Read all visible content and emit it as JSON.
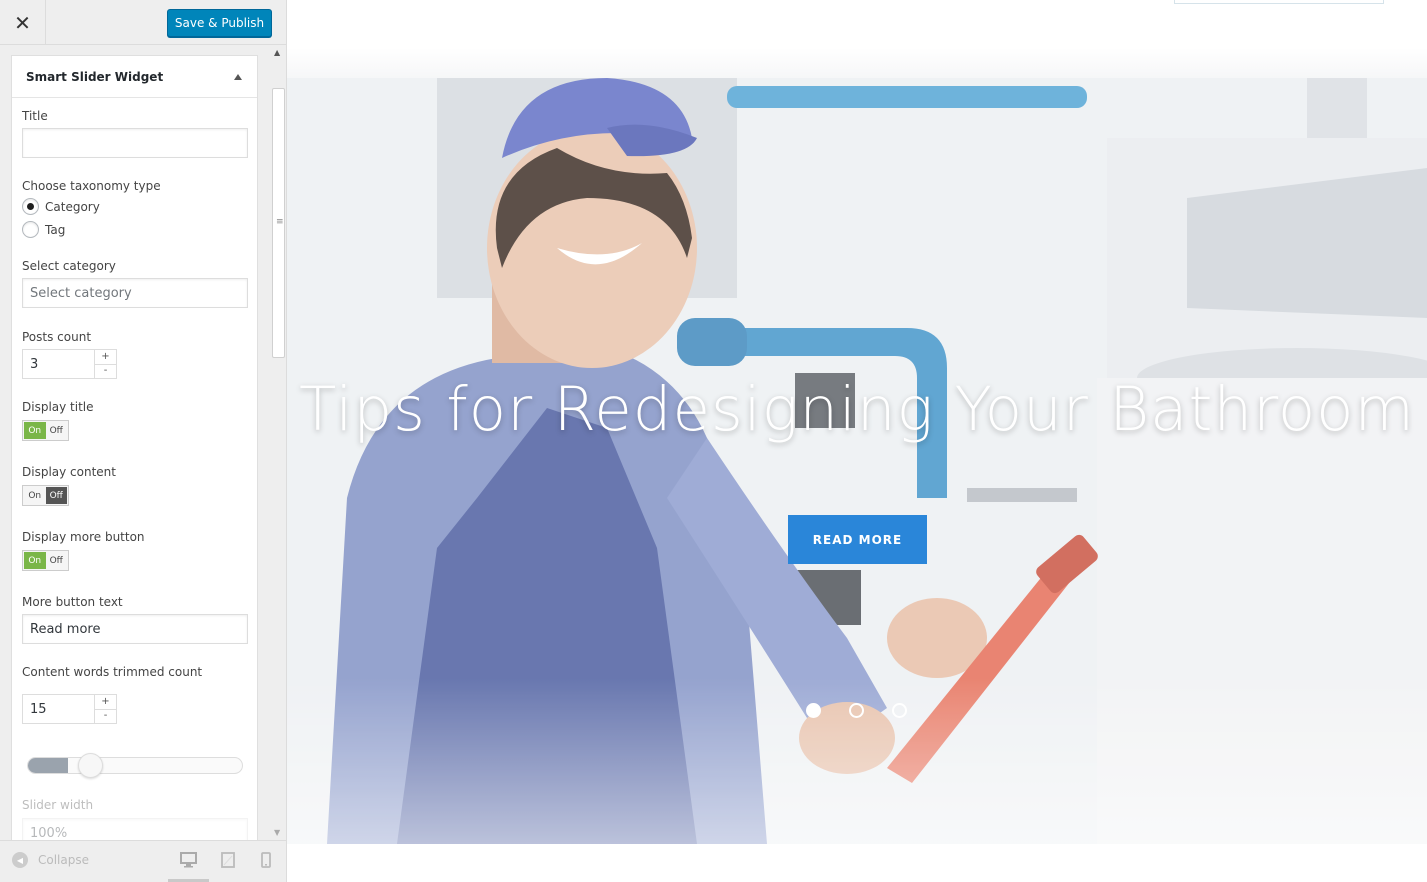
{
  "topbar": {
    "close_glyph": "✕",
    "publish_label": "Save & Publish"
  },
  "widget": {
    "title": "Smart Slider Widget",
    "fields": {
      "title_label": "Title",
      "title_value": "",
      "taxonomy_label": "Choose taxonomy type",
      "taxonomy_options": [
        "Category",
        "Tag"
      ],
      "taxonomy_selected": "Category",
      "category_label": "Select category",
      "category_placeholder": "Select category",
      "posts_count_label": "Posts count",
      "posts_count_value": "3",
      "display_title_label": "Display title",
      "display_title_value": "On",
      "display_content_label": "Display content",
      "display_content_value": "Off",
      "display_more_label": "Display more button",
      "display_more_value": "On",
      "toggle_on": "On",
      "toggle_off": "Off",
      "more_text_label": "More button text",
      "more_text_value": "Read more",
      "trim_label": "Content words trimmed count",
      "trim_value": "15",
      "trim_slider_fraction": 0.15,
      "width_label": "Slider width",
      "width_value": "100%",
      "stepper_plus": "+",
      "stepper_minus": "-"
    }
  },
  "footer": {
    "collapse_label": "Collapse",
    "devices": [
      "desktop-icon",
      "tablet-icon",
      "mobile-icon"
    ],
    "active_device": "desktop"
  },
  "slide": {
    "title": "Tips for Redesigning Your Bathroom",
    "button_label": "READ MORE",
    "dot_count": 3,
    "active_dot": 1
  },
  "colors": {
    "publish": "#0085ba",
    "toggle_on": "#7ab648",
    "toggle_off": "#555555",
    "read_more": "#2a86d9"
  }
}
